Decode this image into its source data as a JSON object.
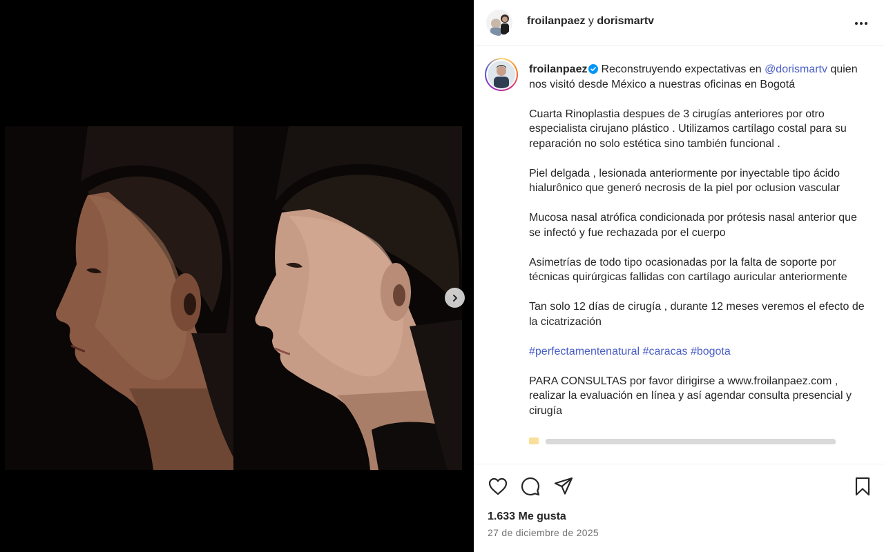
{
  "post": {
    "header": {
      "author": "froilanpaez",
      "connector": "y",
      "collaborator": "dorismartv"
    },
    "caption": {
      "username": "froilanpaez",
      "intro": "Reconstruyendo expectativas en",
      "mention": "@dorismartv",
      "intro_rest": "quien nos visitó desde México a nuestras oficinas en Bogotá",
      "p1": "Cuarta Rinoplastia despues de 3 cirugías anteriores por otro especialista cirujano plástico . Utilizamos cartílago costal para su reparación no solo estética sino también funcional .",
      "p2": "Piel delgada , lesionada anteriormente por inyectable tipo ácido hialurônico que generó necrosis de la piel por oclusion vascular",
      "p3": "Mucosa nasal atrófica condicionada por prótesis nasal anterior que se infectó y fue rechazada por el cuerpo",
      "p4": "Asimetrías de todo tipo ocasionadas por la falta de soporte por técnicas quirúrgicas fallidas con cartílago auricular anteriormente",
      "p5": "Tan solo 12 días de cirugía , durante 12 meses veremos el efecto de la cicatrización",
      "hashtags": [
        "#perfectamentenatural",
        "#caracas",
        "#bogota"
      ],
      "p7": "PARA CONSULTAS por favor dirigirse a www.froilanpaez.com , realizar la evaluación en línea y así agendar consulta presencial y cirugía"
    },
    "likes": "1.633 Me gusta",
    "date": "27 de diciembre de 2025",
    "icons": {
      "like": "heart-icon",
      "comment": "comment-icon",
      "share": "share-icon",
      "save": "bookmark-icon",
      "more": "more-icon",
      "next": "chevron-right-icon",
      "verified": "verified-badge-icon"
    },
    "colors": {
      "link": "#4a5ec7",
      "verified": "#0095f6",
      "text": "#262626",
      "muted": "#737373"
    }
  }
}
